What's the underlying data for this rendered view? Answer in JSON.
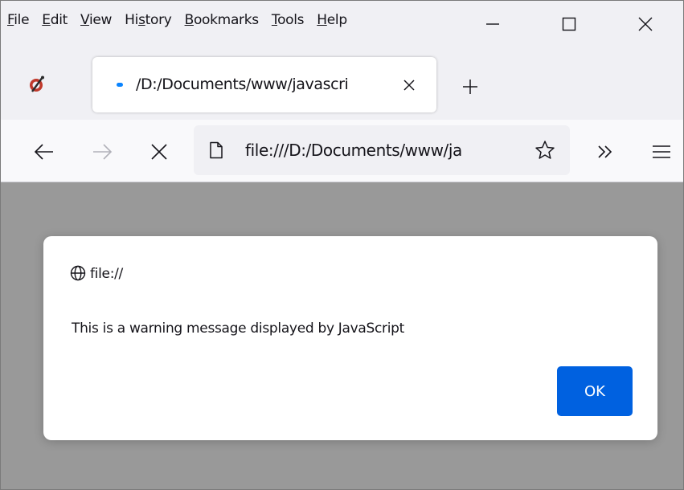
{
  "menubar": {
    "items": [
      {
        "label_ul": "F",
        "label_rest": "ile"
      },
      {
        "label_ul": "E",
        "label_rest": "dit"
      },
      {
        "label_ul": "V",
        "label_rest": "iew"
      },
      {
        "label_pre": "Hi",
        "label_ul": "s",
        "label_rest": "tory"
      },
      {
        "label_ul": "B",
        "label_rest": "ookmarks"
      },
      {
        "label_ul": "T",
        "label_rest": "ools"
      },
      {
        "label_ul": "H",
        "label_rest": "elp"
      }
    ],
    "controls": {
      "minimize": "minimize-icon",
      "maximize": "maximize-icon",
      "close": "close-icon"
    }
  },
  "tabstrip": {
    "active_tab_title": "/D:/Documents/www/javascri",
    "loading_indicator_color": "#0a84ff",
    "close_icon": "close-icon",
    "new_tab_icon": "plus-icon"
  },
  "navbar": {
    "back_icon": "arrow-left-icon",
    "forward_icon": "arrow-right-icon",
    "stop_icon": "close-icon",
    "url": "file:///D:/Documents/www/ja",
    "page_icon": "page-icon",
    "bookmark_icon": "star-icon",
    "overflow_icon": "chevron-double-right-icon",
    "menu_icon": "hamburger-icon"
  },
  "dialog": {
    "origin": "file://",
    "origin_icon": "globe-icon",
    "message": "This is a warning message displayed by JavaScript",
    "ok_label": "OK",
    "ok_color": "#0061e0"
  }
}
